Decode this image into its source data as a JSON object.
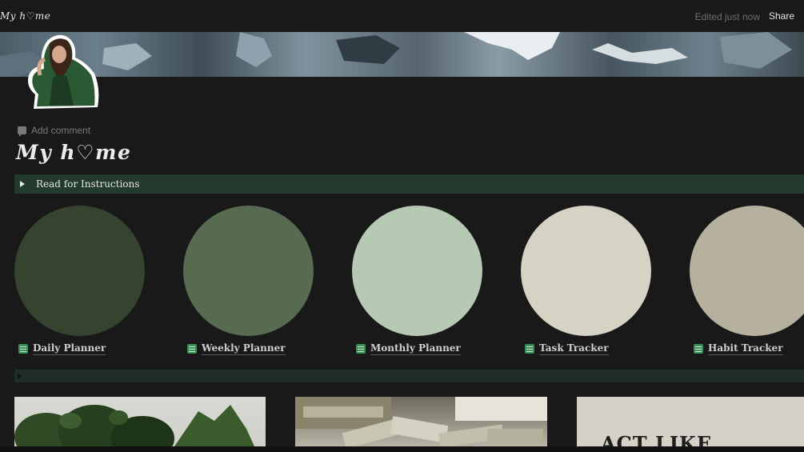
{
  "topbar": {
    "breadcrumb": "My h♡me",
    "edited": "Edited just now",
    "share_label": "Share"
  },
  "page": {
    "add_comment": "Add comment",
    "title": "My h♡me"
  },
  "toggle": {
    "label": "Read for Instructions"
  },
  "links": [
    {
      "label": "Daily Planner",
      "color": "#35432f"
    },
    {
      "label": "Weekly Planner",
      "color": "#576b51"
    },
    {
      "label": "Monthly Planner",
      "color": "#b6c9b2"
    },
    {
      "label": "Task Tracker",
      "color": "#d6d3c5"
    },
    {
      "label": "Habit Tracker",
      "color": "#b6b19f"
    }
  ],
  "gallery": {
    "card3_text": "ACT LIKE"
  },
  "icons": {
    "comment": "comment-icon",
    "database": "database-icon",
    "toggle": "triangle-right-icon"
  },
  "colors": {
    "background": "#191919",
    "toggle_bg": "#233a2e",
    "divider_bg": "#202d27",
    "db_icon": "#3d8f5a"
  }
}
